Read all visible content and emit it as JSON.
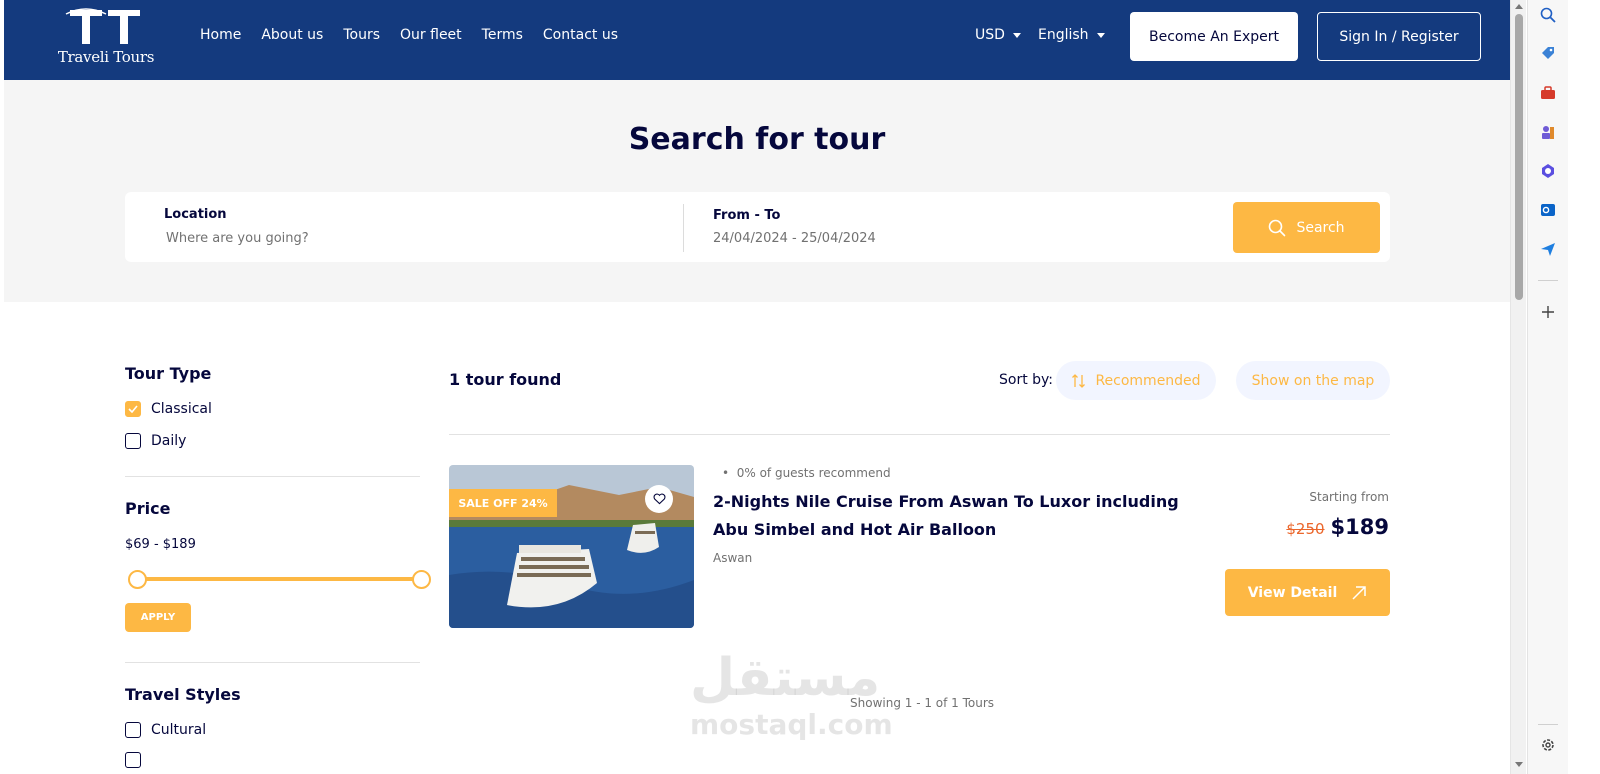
{
  "header": {
    "logo_text": "Traveli Tours",
    "nav": [
      "Home",
      "About us",
      "Tours",
      "Our fleet",
      "Terms",
      "Contact us"
    ],
    "currency": "USD",
    "language": "English",
    "become_expert": "Become An Expert",
    "sign_in": "Sign In / Register"
  },
  "search": {
    "title": "Search for tour",
    "location_label": "Location",
    "location_placeholder": "Where are you going?",
    "dates_label": "From - To",
    "dates_value": "24/04/2024 - 25/04/2024",
    "button": "Search"
  },
  "filters": {
    "tour_type_title": "Tour Type",
    "tour_types": [
      {
        "label": "Classical",
        "checked": true
      },
      {
        "label": "Daily",
        "checked": false
      }
    ],
    "price_title": "Price",
    "price_range": "$69 - $189",
    "apply": "APPLY",
    "travel_styles_title": "Travel Styles",
    "travel_styles": [
      {
        "label": "Cultural",
        "checked": false
      }
    ]
  },
  "results": {
    "count_text": "1 tour found",
    "sort_label": "Sort by:",
    "sort_value": "Recommended",
    "map_button": "Show on the map",
    "tour": {
      "badge": "SALE OFF 24%",
      "recommend": "0% of guests recommend",
      "title": "2-Nights Nile Cruise From Aswan To Luxor including Abu Simbel and Hot Air Balloon",
      "location": "Aswan",
      "starting_from": "Starting from",
      "old_price": "$250",
      "price": "$189",
      "view_button": "View Detail"
    },
    "showing": "Showing 1 - 1 of 1 Tours"
  },
  "watermark": {
    "arabic": "مستقل",
    "latin": "mostaql.com"
  },
  "colors": {
    "header_bg": "#143a7e",
    "accent": "#fdb844",
    "text_dark": "#05073c",
    "hero_bg": "#f5f5f5",
    "old_price": "#eb662b"
  }
}
